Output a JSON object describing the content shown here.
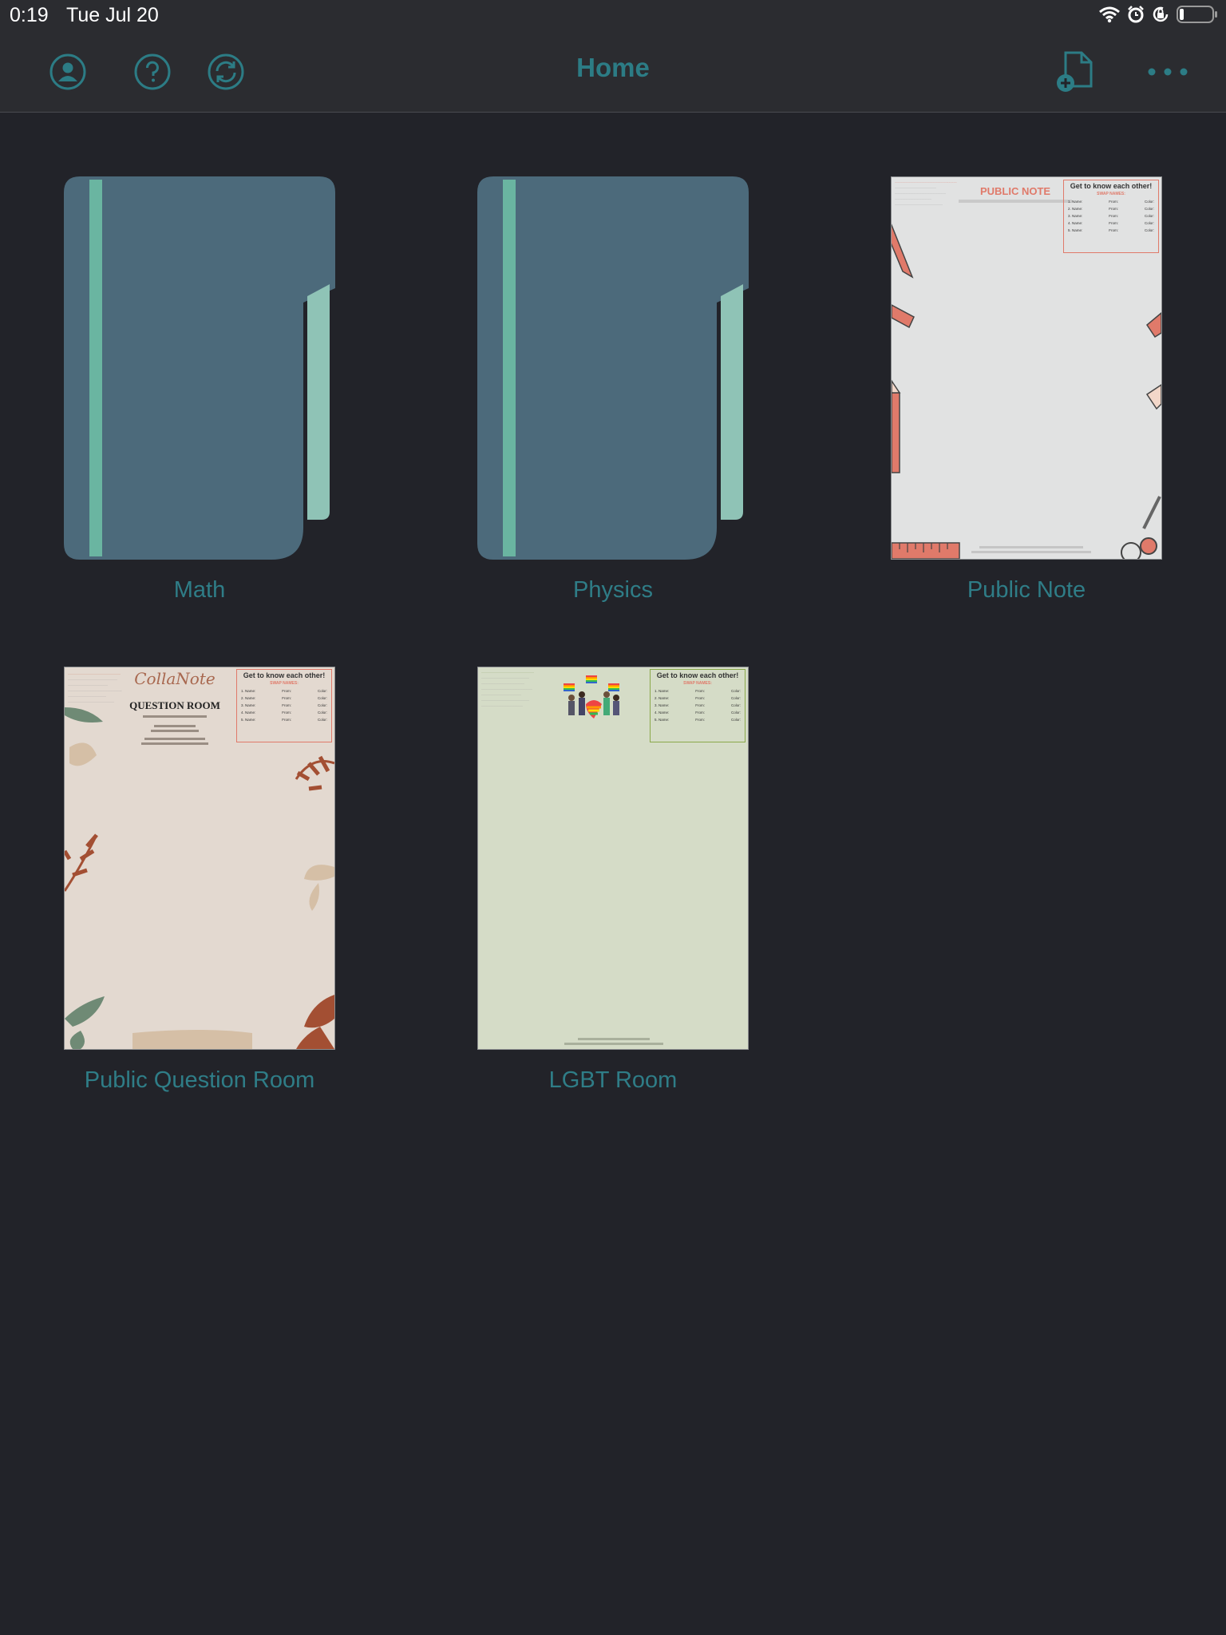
{
  "status_bar": {
    "time": "0:19",
    "date": "Tue Jul 20",
    "icons": [
      "wifi-icon",
      "alarm-icon",
      "rotation-lock-icon",
      "battery-icon"
    ]
  },
  "nav": {
    "title": "Home",
    "left_icons": [
      "profile-icon",
      "help-icon",
      "sync-icon"
    ],
    "right_icons": [
      "new-document-icon",
      "more-icon"
    ]
  },
  "colors": {
    "accent": "#2c7c85",
    "background": "#222329",
    "bar": "#2b2c30",
    "folder": "#4c6a7b",
    "folder_stripe": "#6ab5a1"
  },
  "items": [
    {
      "type": "folder",
      "label": "Math"
    },
    {
      "type": "folder",
      "label": "Physics"
    },
    {
      "type": "note",
      "label": "Public Note",
      "preview": {
        "title": "PUBLIC NOTE",
        "card_title": "Get to know each other!",
        "card_subtitle": "SWAP NAMES:",
        "rows": [
          "1. Name:",
          "2. Name:",
          "3. Name:",
          "4. Name:",
          "5. Name:"
        ],
        "col_from": "From:",
        "col_color": "Color:"
      }
    },
    {
      "type": "note",
      "label": "Public Question Room",
      "preview": {
        "script_title": "CollaNote",
        "title": "QUESTION ROOM",
        "card_title": "Get to know each other!",
        "card_subtitle": "SWAP NAMES:",
        "rows": [
          "1. Name:",
          "2. Name:",
          "3. Name:",
          "4. Name:",
          "5. Name:"
        ],
        "col_from": "From:",
        "col_color": "Color:"
      }
    },
    {
      "type": "note",
      "label": "LGBT Room",
      "preview": {
        "card_title": "Get to know each other!",
        "card_subtitle": "SWAP NAMES:",
        "rows": [
          "1. Name:",
          "2. Name:",
          "3. Name:",
          "4. Name:",
          "5. Name:"
        ],
        "col_from": "From:",
        "col_color": "Color:"
      }
    }
  ]
}
